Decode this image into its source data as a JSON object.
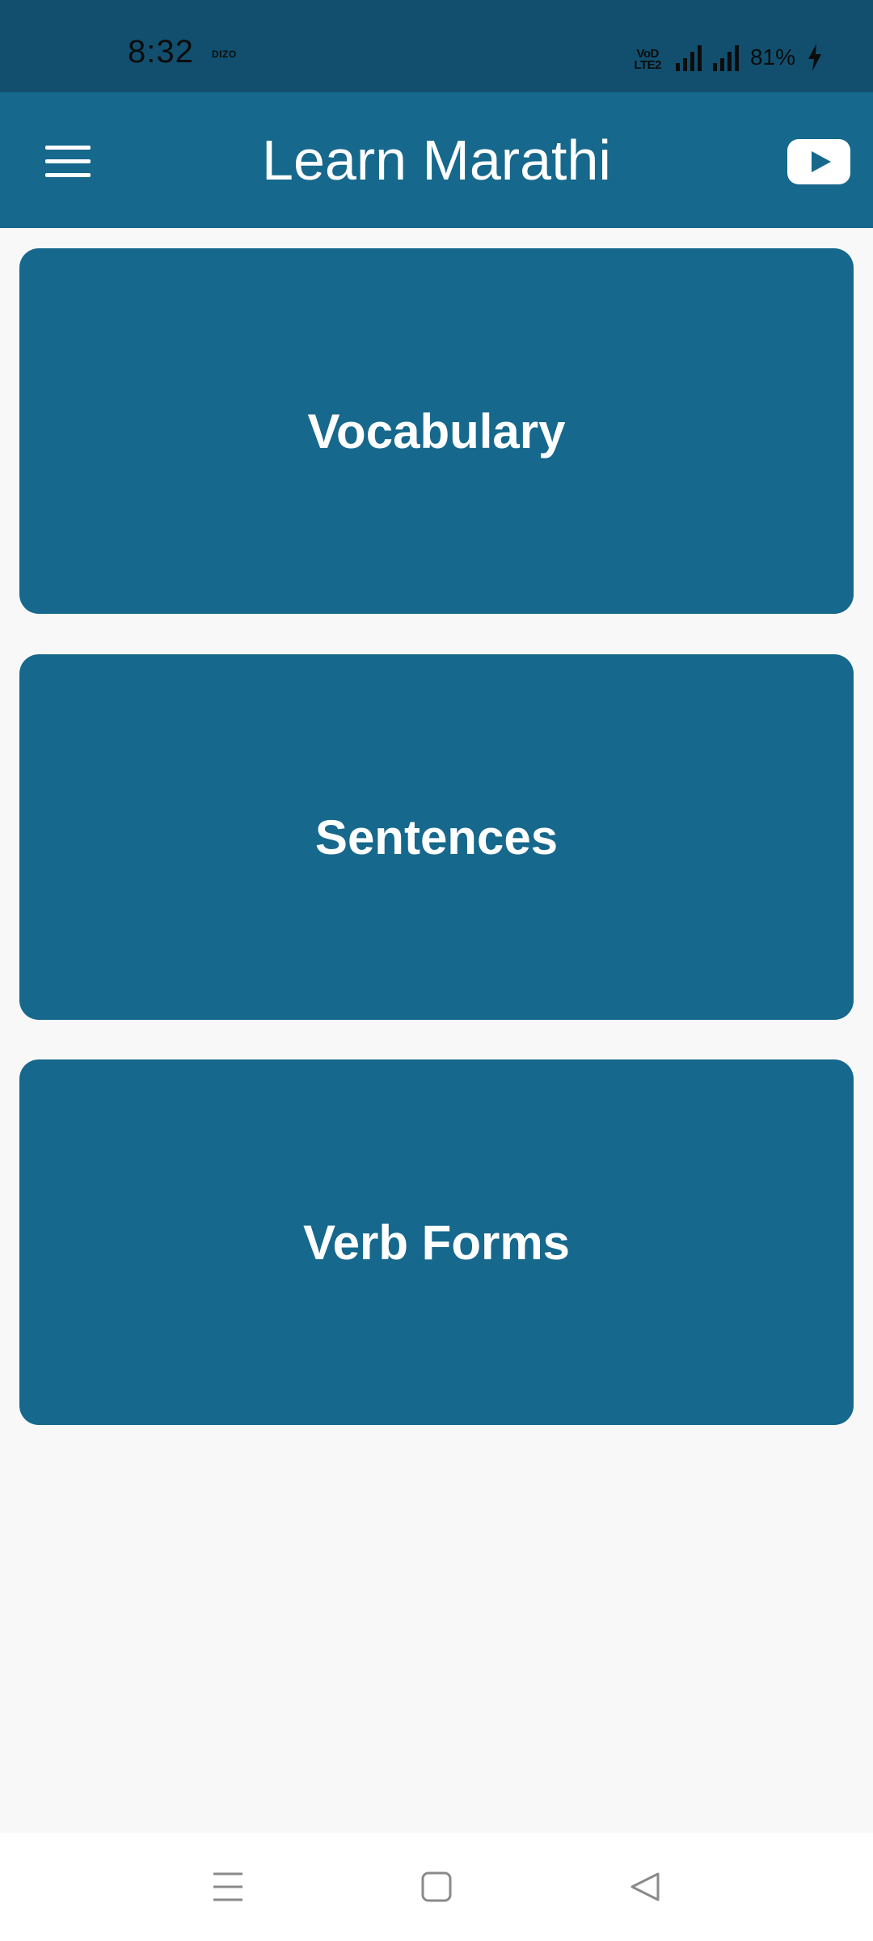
{
  "status_bar": {
    "time": "8:32",
    "brand": "DIZO",
    "volte_top": "VoD",
    "volte_bottom": "LTE2",
    "battery": "81%"
  },
  "app_bar": {
    "title": "Learn Marathi",
    "menu_icon": "hamburger-menu-icon",
    "video_icon": "youtube-play-icon"
  },
  "cards": [
    {
      "label": "Vocabulary"
    },
    {
      "label": "Sentences"
    },
    {
      "label": "Verb Forms"
    }
  ],
  "nav_bar": {
    "items": [
      "recents-icon",
      "home-icon",
      "back-icon"
    ]
  },
  "colors": {
    "status_bar": "#124f6e",
    "primary": "#16688c",
    "background": "#f8f8f8",
    "text_on_primary": "#ffffff",
    "nav_icon": "#8a8a8a"
  }
}
